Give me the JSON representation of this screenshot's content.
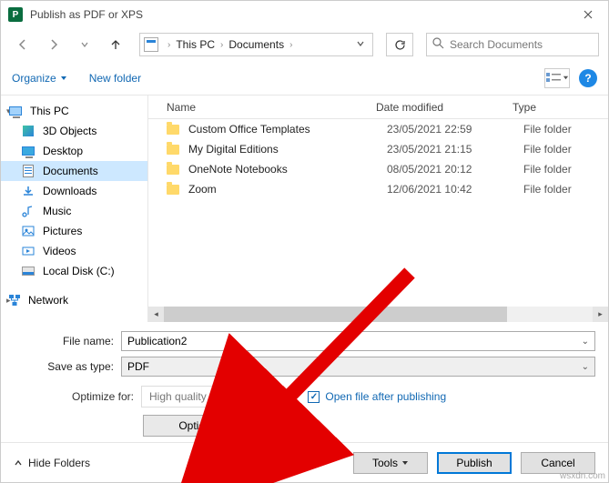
{
  "title": "Publish as PDF or XPS",
  "app_icon_letter": "P",
  "breadcrumb": {
    "root": "This PC",
    "folder": "Documents"
  },
  "search_placeholder": "Search Documents",
  "toolbar": {
    "organize": "Organize",
    "new_folder": "New folder"
  },
  "sidebar": {
    "items": [
      {
        "label": "This PC"
      },
      {
        "label": "3D Objects"
      },
      {
        "label": "Desktop"
      },
      {
        "label": "Documents"
      },
      {
        "label": "Downloads"
      },
      {
        "label": "Music"
      },
      {
        "label": "Pictures"
      },
      {
        "label": "Videos"
      },
      {
        "label": "Local Disk (C:)"
      }
    ],
    "network": "Network"
  },
  "columns": {
    "name": "Name",
    "date": "Date modified",
    "type": "Type"
  },
  "files": [
    {
      "name": "Custom Office Templates",
      "date": "23/05/2021 22:59",
      "type": "File folder"
    },
    {
      "name": "My Digital Editions",
      "date": "23/05/2021 21:15",
      "type": "File folder"
    },
    {
      "name": "OneNote Notebooks",
      "date": "08/05/2021 20:12",
      "type": "File folder"
    },
    {
      "name": "Zoom",
      "date": "12/06/2021 10:42",
      "type": "File folder"
    }
  ],
  "form": {
    "file_name_label": "File name:",
    "file_name_value": "Publication2",
    "save_type_label": "Save as type:",
    "save_type_value": "PDF",
    "optimize_label": "Optimize for:",
    "optimize_value": "High quality printing",
    "open_after_label": "Open file after publishing",
    "options_label": "Options..."
  },
  "footer": {
    "hide_folders": "Hide Folders",
    "tools": "Tools",
    "publish": "Publish",
    "cancel": "Cancel"
  },
  "watermark": "wsxdn.com"
}
